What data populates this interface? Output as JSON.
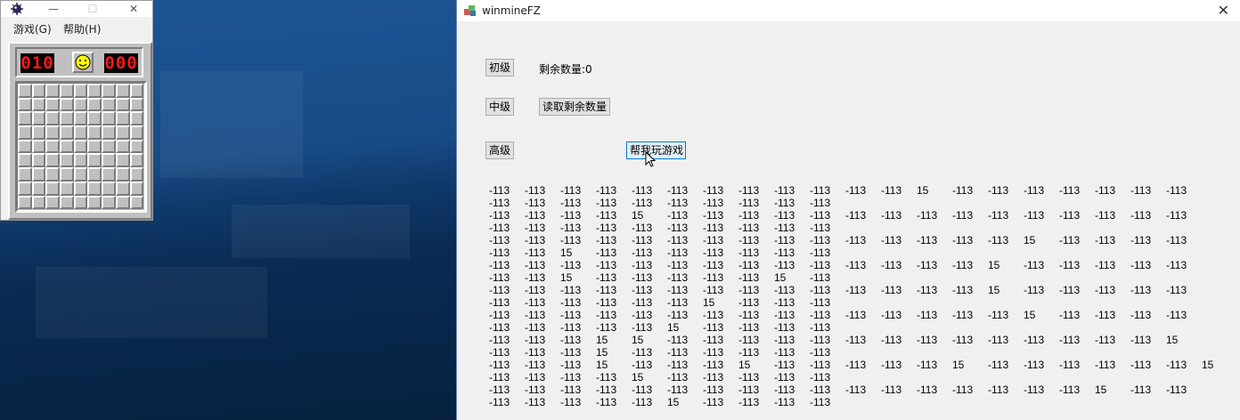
{
  "minesweeper": {
    "menu": [
      "游戏(G)",
      "帮助(H)"
    ],
    "mine_counter": "010",
    "timer": "000",
    "grid_size": 9
  },
  "fz": {
    "title": "winmineFZ",
    "buttons": {
      "beginner": "初级",
      "intermediate": "中级",
      "expert": "高级",
      "read_remaining": "读取剩余数量",
      "help_play": "帮我玩游戏"
    },
    "remaining_label": "剩余数量:0",
    "rows": [
      [
        "-113",
        "-113",
        "-113",
        "-113",
        "-113",
        "-113",
        "-113",
        "-113",
        "-113",
        "-113",
        "-113",
        "-113",
        "15",
        "-113",
        "-113",
        "-113",
        "-113",
        "-113",
        "-113",
        "-113"
      ],
      [
        "-113",
        "-113",
        "-113",
        "-113",
        "-113",
        "-113",
        "-113",
        "-113",
        "-113",
        "-113"
      ],
      [
        "-113",
        "-113",
        "-113",
        "-113",
        "15",
        "-113",
        "-113",
        "-113",
        "-113",
        "-113",
        "-113",
        "-113",
        "-113",
        "-113",
        "-113",
        "-113",
        "-113",
        "-113",
        "-113",
        "-113"
      ],
      [
        "-113",
        "-113",
        "-113",
        "-113",
        "-113",
        "-113",
        "-113",
        "-113",
        "-113",
        "-113"
      ],
      [
        "-113",
        "-113",
        "-113",
        "-113",
        "-113",
        "-113",
        "-113",
        "-113",
        "-113",
        "-113",
        "-113",
        "-113",
        "-113",
        "-113",
        "-113",
        "15",
        "-113",
        "-113",
        "-113",
        "-113"
      ],
      [
        "-113",
        "-113",
        "15",
        "-113",
        "-113",
        "-113",
        "-113",
        "-113",
        "-113",
        "-113"
      ],
      [
        "-113",
        "-113",
        "-113",
        "-113",
        "-113",
        "-113",
        "-113",
        "-113",
        "-113",
        "-113",
        "-113",
        "-113",
        "-113",
        "-113",
        "15",
        "-113",
        "-113",
        "-113",
        "-113",
        "-113"
      ],
      [
        "-113",
        "-113",
        "15",
        "-113",
        "-113",
        "-113",
        "-113",
        "-113",
        "15",
        "-113"
      ],
      [
        "-113",
        "-113",
        "-113",
        "-113",
        "-113",
        "-113",
        "-113",
        "-113",
        "-113",
        "-113",
        "-113",
        "-113",
        "-113",
        "-113",
        "15",
        "-113",
        "-113",
        "-113",
        "-113",
        "-113"
      ],
      [
        "-113",
        "-113",
        "-113",
        "-113",
        "-113",
        "-113",
        "15",
        "-113",
        "-113",
        "-113"
      ],
      [
        "-113",
        "-113",
        "-113",
        "-113",
        "-113",
        "-113",
        "-113",
        "-113",
        "-113",
        "-113",
        "-113",
        "-113",
        "-113",
        "-113",
        "-113",
        "15",
        "-113",
        "-113",
        "-113",
        "-113"
      ],
      [
        "-113",
        "-113",
        "-113",
        "-113",
        "-113",
        "15",
        "-113",
        "-113",
        "-113",
        "-113"
      ],
      [
        "-113",
        "-113",
        "-113",
        "15",
        "15",
        "-113",
        "-113",
        "-113",
        "-113",
        "-113",
        "-113",
        "-113",
        "-113",
        "-113",
        "-113",
        "-113",
        "-113",
        "-113",
        "-113",
        "15"
      ],
      [
        "-113",
        "-113",
        "-113",
        "15",
        "-113",
        "-113",
        "-113",
        "-113",
        "-113",
        "-113"
      ],
      [
        "-113",
        "-113",
        "-113",
        "15",
        "-113",
        "-113",
        "-113",
        "15",
        "-113",
        "-113",
        "-113",
        "-113",
        "-113",
        "15",
        "-113",
        "-113",
        "-113",
        "-113",
        "-113",
        "-113",
        "15"
      ],
      [
        "-113",
        "-113",
        "-113",
        "-113",
        "15",
        "-113",
        "-113",
        "-113",
        "-113",
        "-113"
      ],
      [
        "-113",
        "-113",
        "-113",
        "-113",
        "-113",
        "-113",
        "-113",
        "-113",
        "-113",
        "-113",
        "-113",
        "-113",
        "-113",
        "-113",
        "-113",
        "-113",
        "-113",
        "15",
        "-113",
        "-113"
      ],
      [
        "-113",
        "-113",
        "-113",
        "-113",
        "-113",
        "15",
        "-113",
        "-113",
        "-113",
        "-113"
      ]
    ]
  }
}
